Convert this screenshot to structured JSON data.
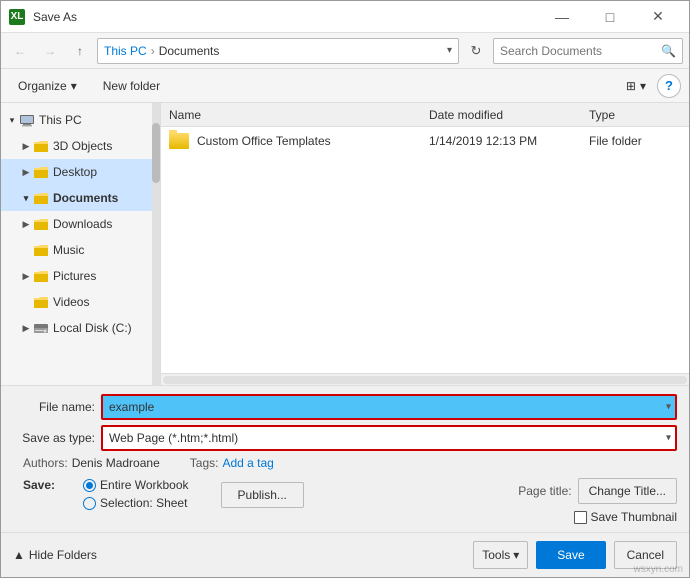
{
  "titleBar": {
    "icon": "XL",
    "title": "Save As",
    "minBtn": "—",
    "maxBtn": "□",
    "closeBtn": "✕"
  },
  "addressBar": {
    "backBtn": "←",
    "forwardBtn": "→",
    "upBtn": "↑",
    "breadcrumb": {
      "thisPC": "This PC",
      "sep": "›",
      "current": "Documents"
    },
    "refreshBtn": "↻",
    "dropBtn": "▾",
    "searchPlaceholder": "Search Documents",
    "searchIcon": "🔍"
  },
  "toolbar": {
    "organize": "Organize",
    "organizeArrow": "▾",
    "newFolder": "New folder",
    "viewIcon": "⊞",
    "helpBtn": "?"
  },
  "sidebar": {
    "items": [
      {
        "id": "this-pc",
        "label": "This PC",
        "icon": "pc",
        "indent": 0,
        "hasArrow": true,
        "arrowOpen": true,
        "selected": false
      },
      {
        "id": "3d-objects",
        "label": "3D Objects",
        "icon": "folder",
        "indent": 1,
        "hasArrow": true,
        "arrowOpen": false,
        "selected": false
      },
      {
        "id": "desktop",
        "label": "Desktop",
        "icon": "folder",
        "indent": 1,
        "hasArrow": true,
        "arrowOpen": false,
        "selected": false,
        "highlighted": true
      },
      {
        "id": "documents",
        "label": "Documents",
        "icon": "folder",
        "indent": 1,
        "hasArrow": true,
        "arrowOpen": false,
        "selected": true
      },
      {
        "id": "downloads",
        "label": "Downloads",
        "icon": "folder",
        "indent": 1,
        "hasArrow": true,
        "arrowOpen": false,
        "selected": false
      },
      {
        "id": "music",
        "label": "Music",
        "icon": "folder",
        "indent": 1,
        "hasArrow": false,
        "arrowOpen": false,
        "selected": false
      },
      {
        "id": "pictures",
        "label": "Pictures",
        "icon": "folder",
        "indent": 1,
        "hasArrow": true,
        "arrowOpen": false,
        "selected": false
      },
      {
        "id": "videos",
        "label": "Videos",
        "icon": "folder",
        "indent": 1,
        "hasArrow": false,
        "arrowOpen": false,
        "selected": false
      },
      {
        "id": "local-disk",
        "label": "Local Disk (C:)",
        "icon": "drive",
        "indent": 1,
        "hasArrow": true,
        "arrowOpen": false,
        "selected": false
      }
    ]
  },
  "fileList": {
    "columns": {
      "name": "Name",
      "dateModified": "Date modified",
      "type": "Type"
    },
    "files": [
      {
        "name": "Custom Office Templates",
        "dateModified": "1/14/2019 12:13 PM",
        "type": "File folder",
        "icon": "folder"
      }
    ]
  },
  "form": {
    "fileNameLabel": "File name:",
    "fileNameValue": "example",
    "saveAsTypeLabel": "Save as type:",
    "saveAsTypeValue": "Web Page (*.htm;*.html)",
    "authorsLabel": "Authors:",
    "authorsValue": "Denis Madroane",
    "tagsLabel": "Tags:",
    "tagsAddLabel": "Add a tag",
    "saveLabel": "Save:",
    "saveOptions": [
      {
        "id": "entire",
        "label": "Entire Workbook",
        "selected": true
      },
      {
        "id": "selection",
        "label": "Selection: Sheet",
        "selected": false
      }
    ],
    "publishBtn": "Publish...",
    "pageTitleLabel": "Page title:",
    "changeTitleBtn": "Change Title...",
    "saveThumbnailLabel": "Save Thumbnail"
  },
  "footer": {
    "hideFolders": "Hide Folders",
    "arrowIcon": "▲",
    "toolsBtn": "Tools",
    "toolsArrow": "▾",
    "saveBtn": "Save",
    "cancelBtn": "Cancel"
  },
  "watermark": "wsxyn.com"
}
